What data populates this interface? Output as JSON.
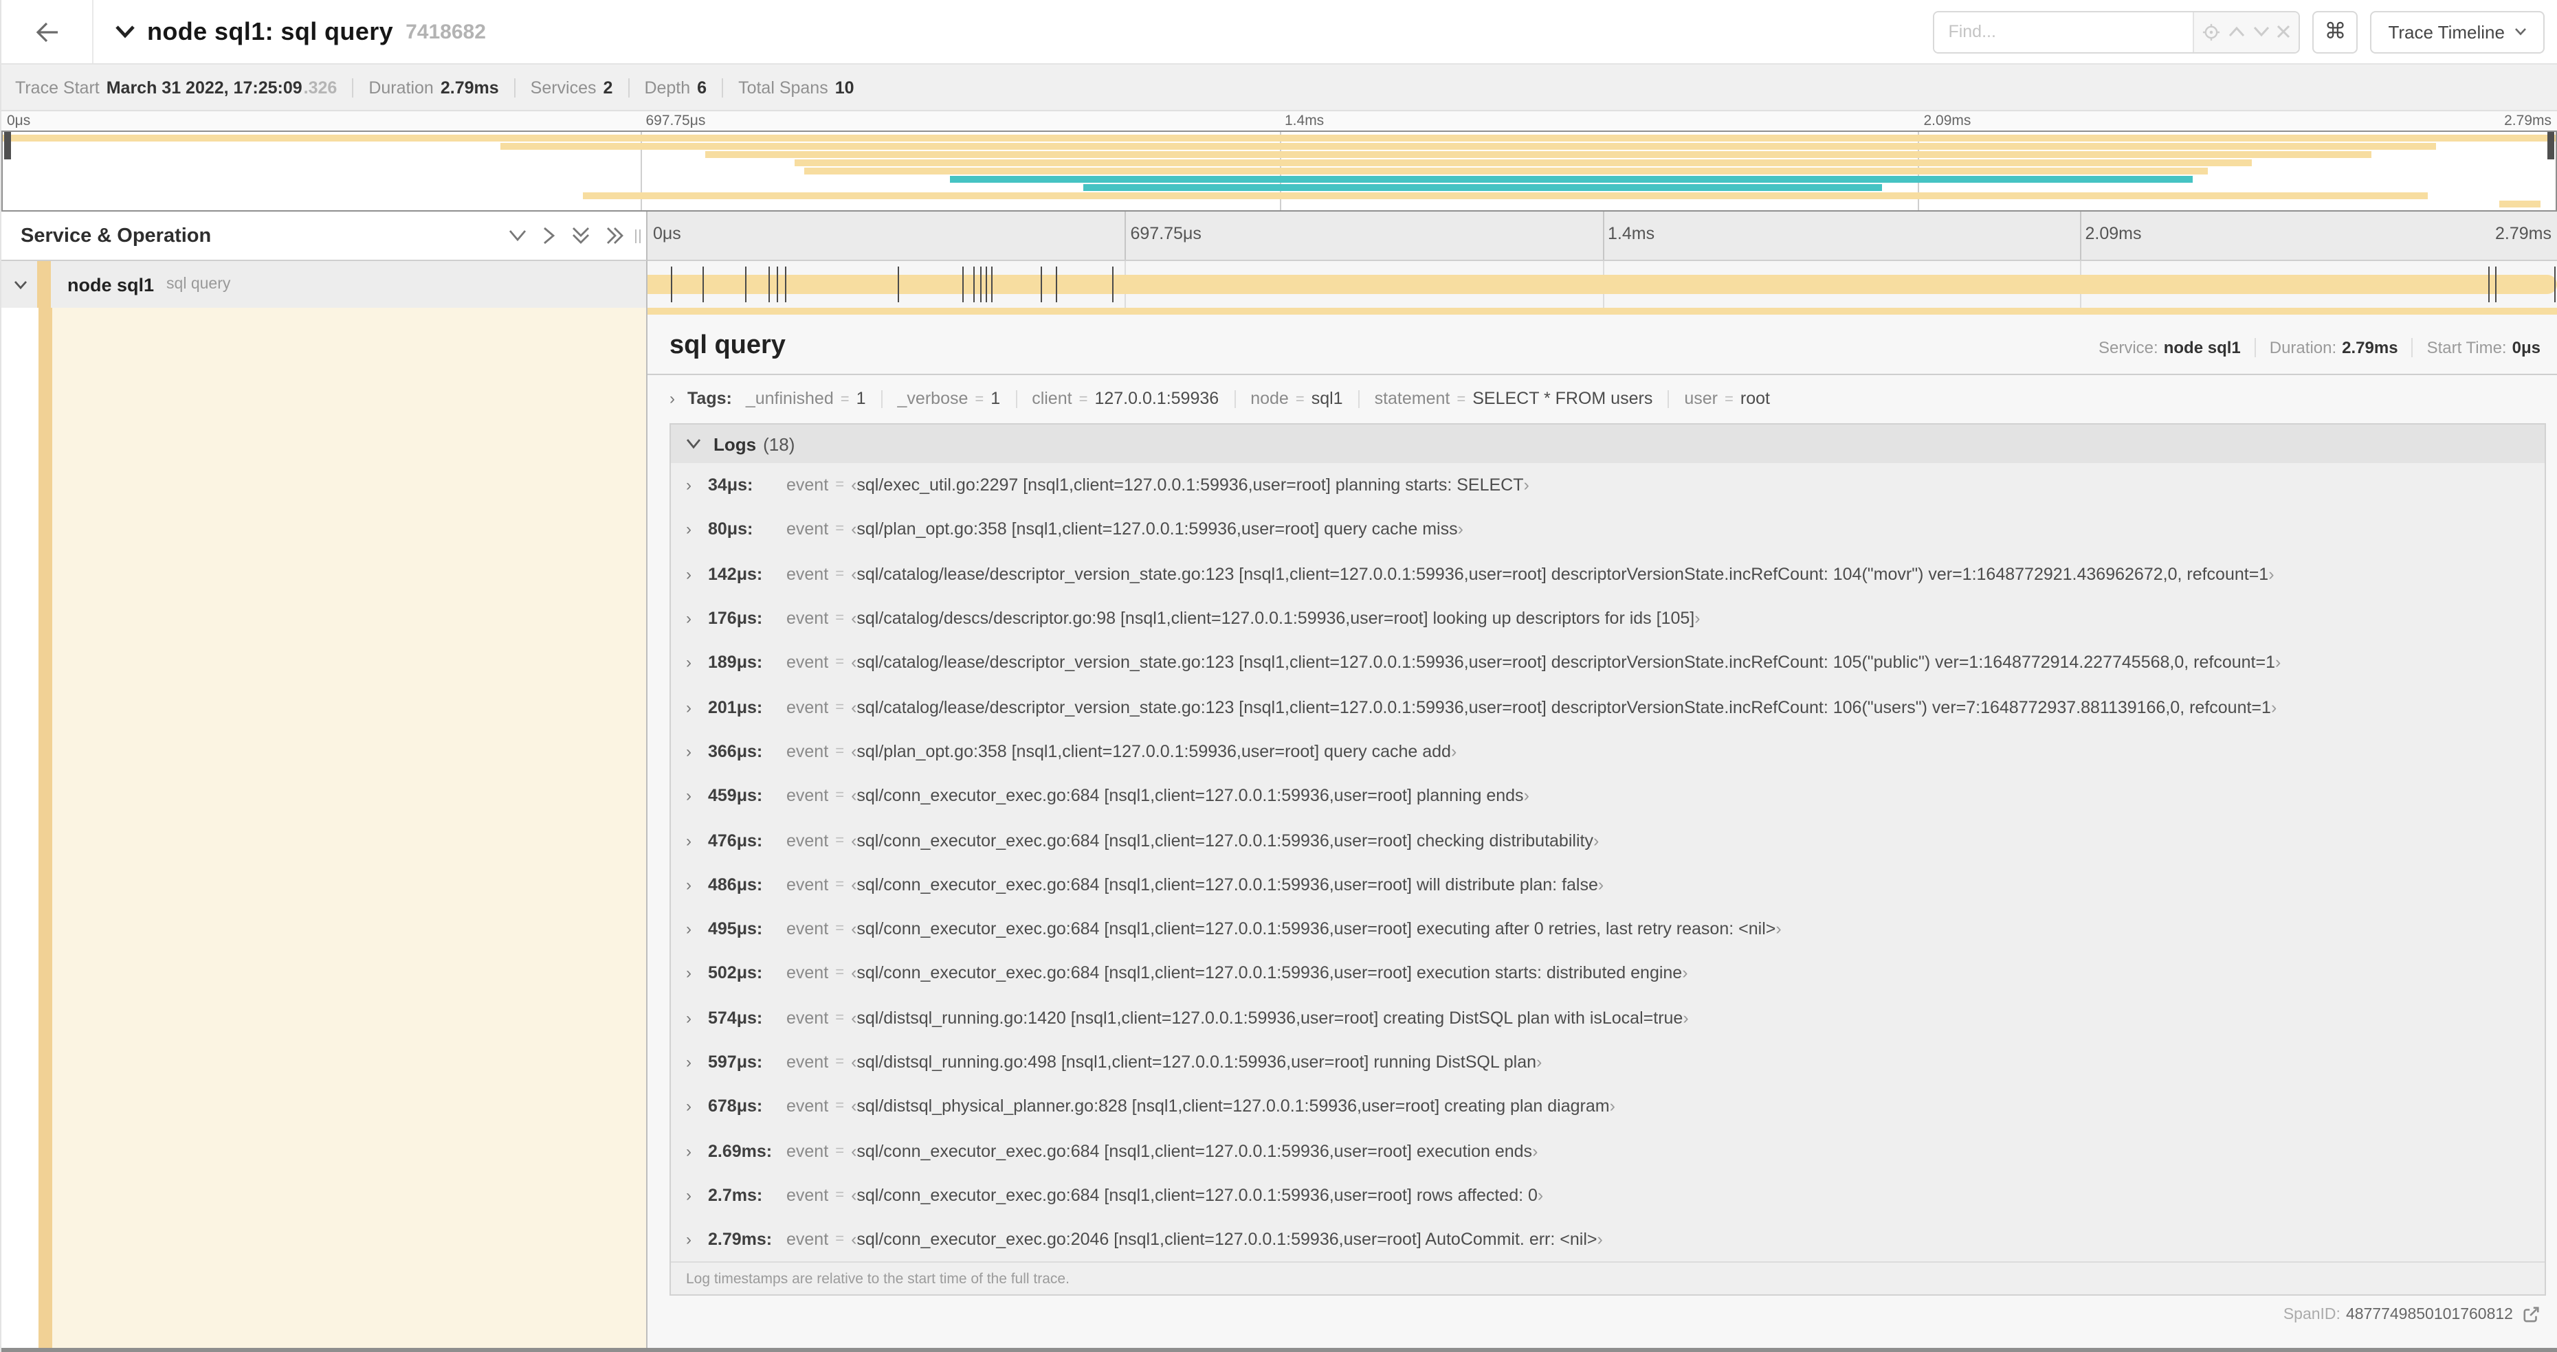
{
  "colors": {
    "tan": "#f7dda0",
    "teal": "#45c3c3",
    "accent_strip": "#f1d195"
  },
  "punct": {
    "eq": "=",
    "open_quote": "‹",
    "close_quote": "›",
    "caret_right": "›",
    "caret_down": "∨",
    "colon": ":"
  },
  "header": {
    "title": "node sql1: sql query",
    "trace_id": "7418682",
    "find_placeholder": "Find...",
    "shortcut_key": "⌘",
    "view_selector": "Trace Timeline"
  },
  "trace_info": {
    "items": [
      {
        "label": "Trace Start",
        "value": "March 31 2022, 17:25:09",
        "suffix": ".326"
      },
      {
        "label": "Duration",
        "value": "2.79ms"
      },
      {
        "label": "Services",
        "value": "2"
      },
      {
        "label": "Depth",
        "value": "6"
      },
      {
        "label": "Total Spans",
        "value": "10"
      }
    ]
  },
  "timeline": {
    "ticks": [
      "0μs",
      "697.75μs",
      "1.4ms",
      "2.09ms",
      "2.79ms"
    ],
    "total_us": 2790
  },
  "minimap": {
    "spans": [
      {
        "start": 0,
        "end": 100,
        "color": "tan"
      },
      {
        "start": 19.5,
        "end": 95.3,
        "color": "tan"
      },
      {
        "start": 27.5,
        "end": 92.8,
        "color": "tan"
      },
      {
        "start": 31.0,
        "end": 88.1,
        "color": "tan"
      },
      {
        "start": 31.4,
        "end": 86.4,
        "color": "tan"
      },
      {
        "start": 37.1,
        "end": 85.8,
        "color": "teal"
      },
      {
        "start": 42.3,
        "end": 73.6,
        "color": "teal"
      },
      {
        "start": 22.7,
        "end": 95.0,
        "color": "tan"
      },
      {
        "start": 97.8,
        "end": 99.4,
        "color": "tan"
      }
    ]
  },
  "sidebar_header": {
    "title": "Service & Operation"
  },
  "span_row": {
    "service": "node sql1",
    "operation": "sql query"
  },
  "detail": {
    "title": "sql query",
    "meta": [
      {
        "label": "Service:",
        "value": "node sql1"
      },
      {
        "label": "Duration:",
        "value": "2.79ms"
      },
      {
        "label": "Start Time:",
        "value": "0μs"
      }
    ],
    "tags": {
      "label": "Tags:",
      "items": [
        {
          "key": "_unfinished",
          "value": "1"
        },
        {
          "key": "_verbose",
          "value": "1"
        },
        {
          "key": "client",
          "value": "127.0.0.1:59936"
        },
        {
          "key": "node",
          "value": "sql1"
        },
        {
          "key": "statement",
          "value": "SELECT * FROM users"
        },
        {
          "key": "user",
          "value": "root"
        }
      ]
    },
    "logs": {
      "label": "Logs",
      "count_label": "(18)",
      "entries": [
        {
          "time": "34μs",
          "t_us": 34,
          "key": "event",
          "value": "sql/exec_util.go:2297 [nsql1,client=127.0.0.1:59936,user=root] planning starts: SELECT"
        },
        {
          "time": "80μs",
          "t_us": 80,
          "key": "event",
          "value": "sql/plan_opt.go:358 [nsql1,client=127.0.0.1:59936,user=root] query cache miss"
        },
        {
          "time": "142μs",
          "t_us": 142,
          "key": "event",
          "value": "sql/catalog/lease/descriptor_version_state.go:123 [nsql1,client=127.0.0.1:59936,user=root] descriptorVersionState.incRefCount: 104(\"movr\") ver=1:1648772921.436962672,0, refcount=1"
        },
        {
          "time": "176μs",
          "t_us": 176,
          "key": "event",
          "value": "sql/catalog/descs/descriptor.go:98 [nsql1,client=127.0.0.1:59936,user=root] looking up descriptors for ids [105]"
        },
        {
          "time": "189μs",
          "t_us": 189,
          "key": "event",
          "value": "sql/catalog/lease/descriptor_version_state.go:123 [nsql1,client=127.0.0.1:59936,user=root] descriptorVersionState.incRefCount: 105(\"public\") ver=1:1648772914.227745568,0, refcount=1"
        },
        {
          "time": "201μs",
          "t_us": 201,
          "key": "event",
          "value": "sql/catalog/lease/descriptor_version_state.go:123 [nsql1,client=127.0.0.1:59936,user=root] descriptorVersionState.incRefCount: 106(\"users\") ver=7:1648772937.881139166,0, refcount=1"
        },
        {
          "time": "366μs",
          "t_us": 366,
          "key": "event",
          "value": "sql/plan_opt.go:358 [nsql1,client=127.0.0.1:59936,user=root] query cache add"
        },
        {
          "time": "459μs",
          "t_us": 459,
          "key": "event",
          "value": "sql/conn_executor_exec.go:684 [nsql1,client=127.0.0.1:59936,user=root] planning ends"
        },
        {
          "time": "476μs",
          "t_us": 476,
          "key": "event",
          "value": "sql/conn_executor_exec.go:684 [nsql1,client=127.0.0.1:59936,user=root] checking distributability"
        },
        {
          "time": "486μs",
          "t_us": 486,
          "key": "event",
          "value": "sql/conn_executor_exec.go:684 [nsql1,client=127.0.0.1:59936,user=root] will distribute plan: false"
        },
        {
          "time": "495μs",
          "t_us": 495,
          "key": "event",
          "value": "sql/conn_executor_exec.go:684 [nsql1,client=127.0.0.1:59936,user=root] executing after 0 retries, last retry reason: <nil>"
        },
        {
          "time": "502μs",
          "t_us": 502,
          "key": "event",
          "value": "sql/conn_executor_exec.go:684 [nsql1,client=127.0.0.1:59936,user=root] execution starts: distributed engine"
        },
        {
          "time": "574μs",
          "t_us": 574,
          "key": "event",
          "value": "sql/distsql_running.go:1420 [nsql1,client=127.0.0.1:59936,user=root] creating DistSQL plan with isLocal=true"
        },
        {
          "time": "597μs",
          "t_us": 597,
          "key": "event",
          "value": "sql/distsql_running.go:498 [nsql1,client=127.0.0.1:59936,user=root] running DistSQL plan"
        },
        {
          "time": "678μs",
          "t_us": 678,
          "key": "event",
          "value": "sql/distsql_physical_planner.go:828 [nsql1,client=127.0.0.1:59936,user=root] creating plan diagram"
        },
        {
          "time": "2.69ms",
          "t_us": 2690,
          "key": "event",
          "value": "sql/conn_executor_exec.go:684 [nsql1,client=127.0.0.1:59936,user=root] execution ends"
        },
        {
          "time": "2.7ms",
          "t_us": 2700,
          "key": "event",
          "value": "sql/conn_executor_exec.go:684 [nsql1,client=127.0.0.1:59936,user=root] rows affected: 0"
        },
        {
          "time": "2.79ms",
          "t_us": 2790,
          "key": "event",
          "value": "sql/conn_executor_exec.go:2046 [nsql1,client=127.0.0.1:59936,user=root] AutoCommit. err: <nil>"
        }
      ],
      "footer": "Log timestamps are relative to the start time of the full trace."
    },
    "span_id_label": "SpanID:",
    "span_id": "4877749850101760812"
  }
}
